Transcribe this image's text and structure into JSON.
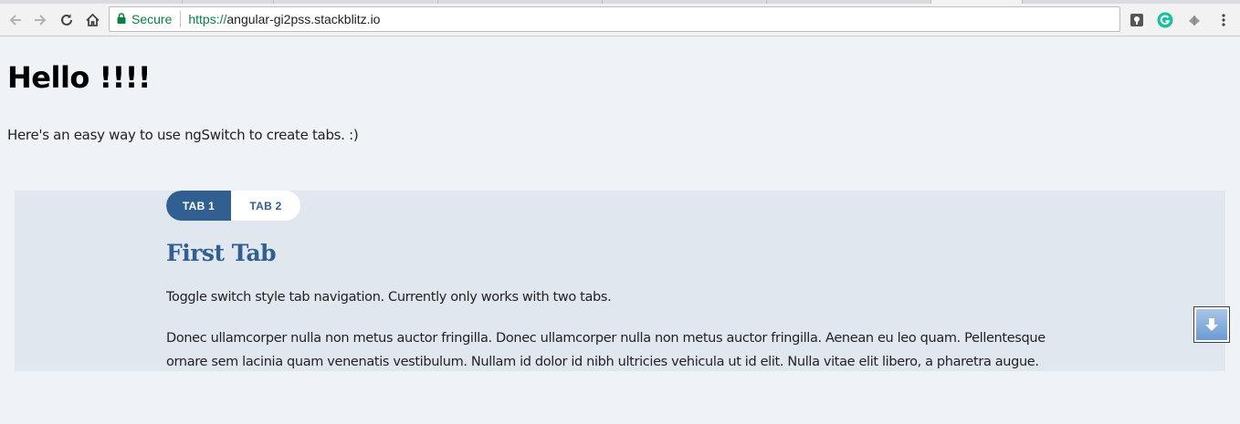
{
  "browser": {
    "secure_label": "Secure",
    "url_scheme": "https://",
    "url_host": "angular-gi2pss.stackblitz.io"
  },
  "page": {
    "title": "Hello !!!!",
    "intro": "Here's an easy way to use ngSwitch to create tabs. :)"
  },
  "tabs": {
    "items": [
      {
        "label": "TAB 1",
        "active": true
      },
      {
        "label": "TAB 2",
        "active": false
      }
    ]
  },
  "panel": {
    "heading": "First Tab",
    "paragraph_1": "Toggle switch style tab navigation. Currently only works with two tabs.",
    "paragraph_2": "Donec ullamcorper nulla non metus auctor fringilla. Donec ullamcorper nulla non metus auctor fringilla. Aenean eu leo quam. Pellentesque ornare sem lacinia quam venenatis vestibulum. Nullam id dolor id nibh ultricies vehicula ut id elit. Nulla vitae elit libero, a pharetra augue."
  },
  "colors": {
    "accent": "#325f92",
    "panel_bg": "#e1e7ef",
    "page_bg": "#eff2f6",
    "secure_green": "#0b8043"
  },
  "icons": {
    "toolbar": [
      "back-arrow-icon",
      "forward-arrow-icon",
      "reload-icon",
      "home-icon",
      "lock-icon"
    ],
    "extensions": [
      "extension-icon",
      "grammarly-icon",
      "extension-gray-icon",
      "menu-dots-icon"
    ],
    "page": [
      "scroll-down-icon"
    ]
  }
}
